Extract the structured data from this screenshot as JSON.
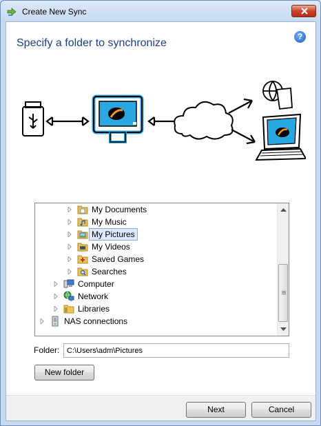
{
  "window": {
    "title": "Create New Sync"
  },
  "header": {
    "heading": "Specify a folder to synchronize",
    "help_icon": "?"
  },
  "tree": {
    "items": [
      {
        "label": "My Documents",
        "icon": "documents-folder-icon",
        "expandable": true
      },
      {
        "label": "My Music",
        "icon": "music-folder-icon",
        "expandable": true
      },
      {
        "label": "My Pictures",
        "icon": "pictures-folder-icon",
        "expandable": true,
        "selected": true
      },
      {
        "label": "My Videos",
        "icon": "videos-folder-icon",
        "expandable": true
      },
      {
        "label": "Saved Games",
        "icon": "games-folder-icon",
        "expandable": true
      },
      {
        "label": "Searches",
        "icon": "searches-folder-icon",
        "expandable": true
      },
      {
        "label": "Computer",
        "icon": "computer-icon",
        "expandable": true
      },
      {
        "label": "Network",
        "icon": "network-icon",
        "expandable": true
      },
      {
        "label": "Libraries",
        "icon": "libraries-folder-icon",
        "expandable": true
      },
      {
        "label": "NAS connections",
        "icon": "nas-icon",
        "expandable": true
      }
    ]
  },
  "folder": {
    "label": "Folder:",
    "value": "C:\\Users\\adm\\Pictures"
  },
  "buttons": {
    "new_folder": "New folder",
    "next": "Next",
    "cancel": "Cancel"
  },
  "colors": {
    "heading": "#1e3f8c",
    "selection": "#dceafb",
    "accent": "#29a7e1"
  }
}
